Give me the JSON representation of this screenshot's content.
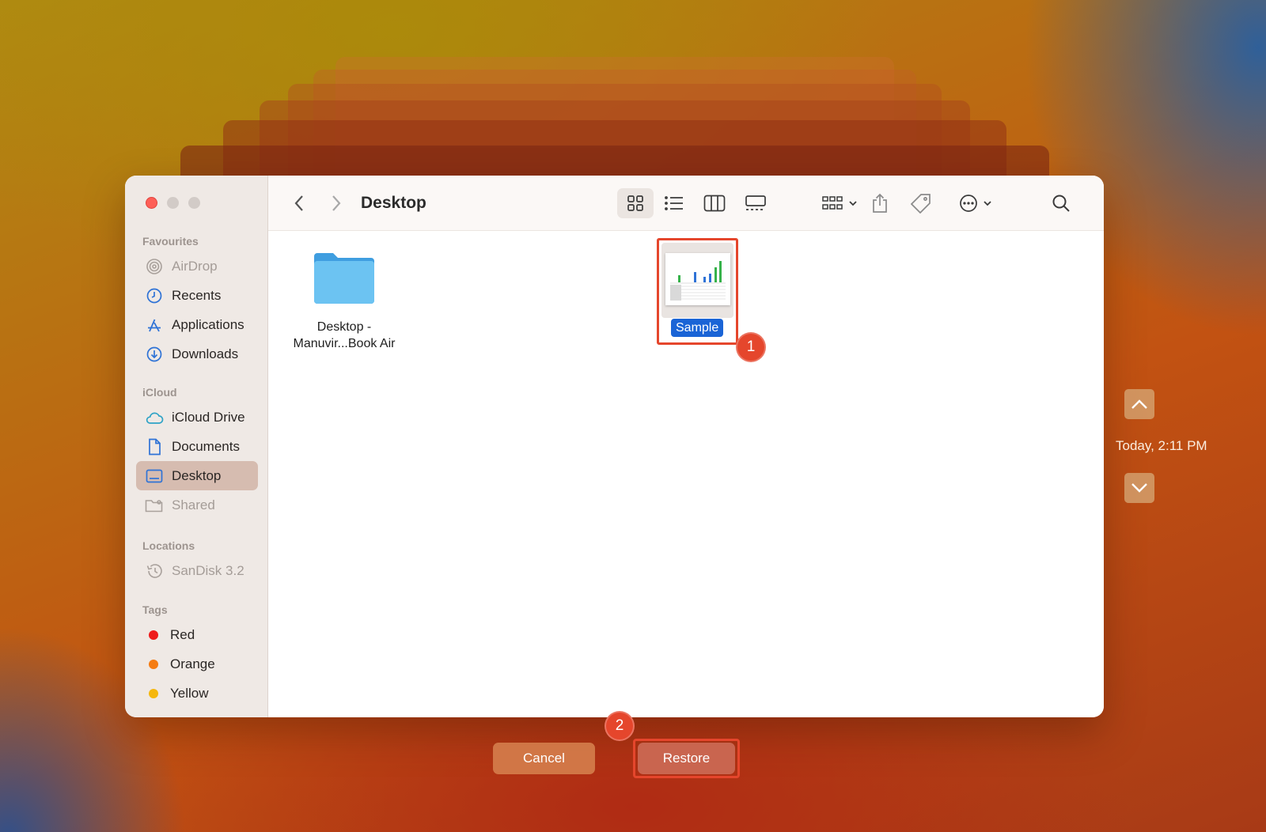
{
  "window": {
    "title": "Desktop"
  },
  "sidebar": {
    "sections": {
      "favourites": "Favourites",
      "icloud": "iCloud",
      "locations": "Locations",
      "tags": "Tags"
    },
    "items": {
      "airdrop": "AirDrop",
      "recents": "Recents",
      "applications": "Applications",
      "downloads": "Downloads",
      "icloud_drive": "iCloud Drive",
      "documents": "Documents",
      "desktop": "Desktop",
      "shared": "Shared",
      "sandisk": "SanDisk 3.2",
      "red": "Red",
      "orange": "Orange",
      "yellow": "Yellow"
    },
    "selected": "Desktop"
  },
  "files": {
    "folder_line1": "Desktop -",
    "folder_line2": "Manuvir...Book Air",
    "sample": "Sample"
  },
  "timeline": {
    "label": "Today, 2:11 PM"
  },
  "buttons": {
    "cancel": "Cancel",
    "restore": "Restore"
  },
  "annotations": {
    "step1": "1",
    "step2": "2"
  },
  "colors": {
    "accent_blue": "#1a64d6",
    "highlight_red": "#e5462c",
    "tag_red": "#ee1b1b",
    "tag_orange": "#f57c12",
    "tag_yellow": "#f5b70e",
    "selected_sidebar": "#d6bcb0"
  }
}
